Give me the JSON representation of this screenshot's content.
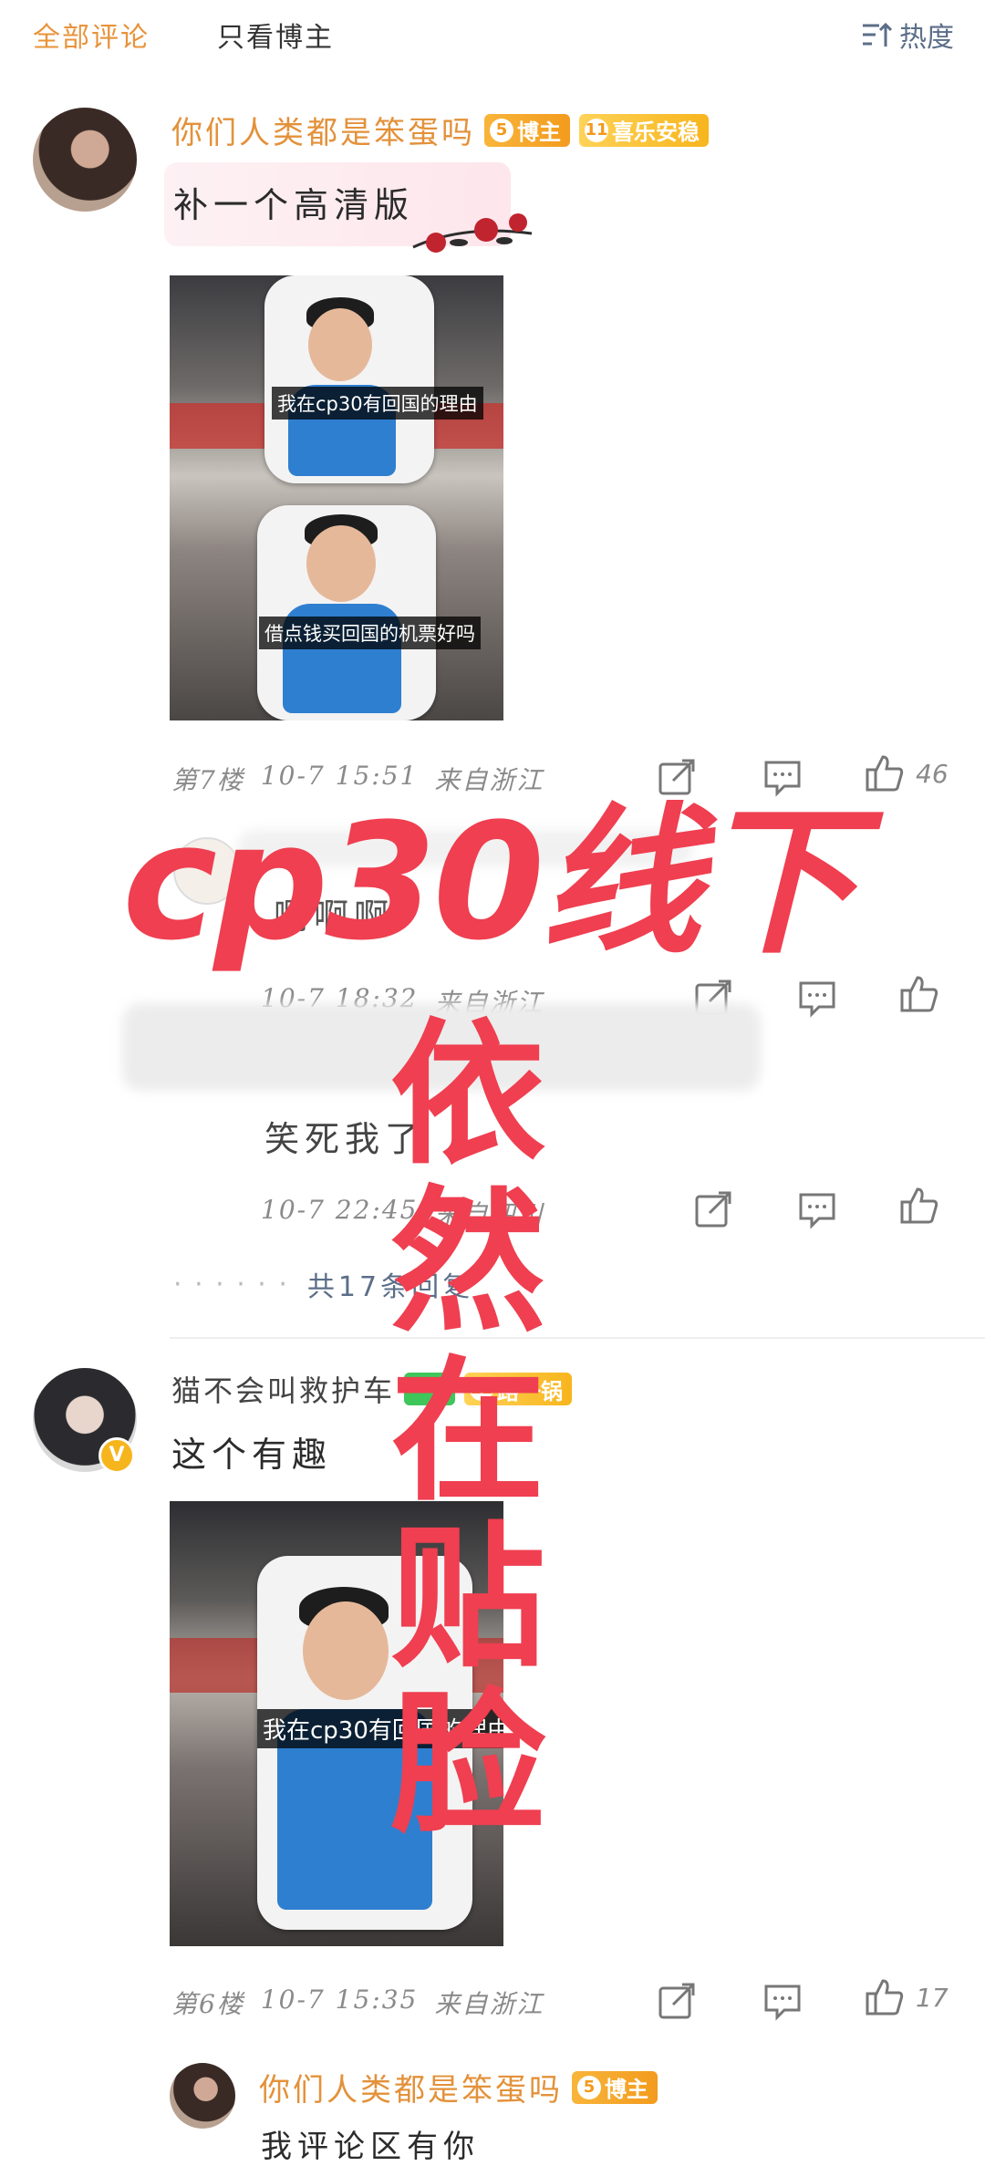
{
  "tabs": {
    "all": "全部评论",
    "blogger_only": "只看博主",
    "sort": "热度"
  },
  "comments": [
    {
      "user": "你们人类都是笨蛋吗",
      "badge_blogger_level": "5",
      "badge_blogger": "博主",
      "badge_fan_level": "11",
      "badge_fan": "喜乐安稳",
      "text": "补一个高清版",
      "photo_caption_1": "我在cp30有回国的理由",
      "photo_caption_2": "借点钱买回国的机票好吗",
      "floor": "第7楼",
      "time": "10-7 15:51",
      "location": "来自浙江",
      "likes": "46"
    },
    {
      "text": "啊啊啊",
      "time": "10-7 18:32",
      "location": "来自浙江"
    },
    {
      "text": "笑死我了",
      "time": "10-7 22:45",
      "location": "来自四川"
    }
  ],
  "replies_more": "共17条回复",
  "comment2": {
    "user": "猫不会叫救护车",
    "badge_fan_level": "12",
    "badge_fan": "路一锅",
    "text": "这个有趣",
    "photo_caption": "我在cp30有回国的理由",
    "floor": "第6楼",
    "time": "10-7 15:35",
    "location": "来自浙江",
    "likes": "17"
  },
  "reply_preview": {
    "user": "你们人类都是笨蛋吗",
    "badge_blogger_level": "5",
    "badge_blogger": "博主",
    "text": "我评论区有你"
  },
  "overlay": {
    "line1": "cp30线下",
    "c1": "依",
    "c2": "然",
    "c3": "在",
    "c4": "贴",
    "c5": "脸"
  },
  "colors": {
    "accent": "#e8933a",
    "overlay": "#ef3f50",
    "meta": "#8a8a8a"
  }
}
